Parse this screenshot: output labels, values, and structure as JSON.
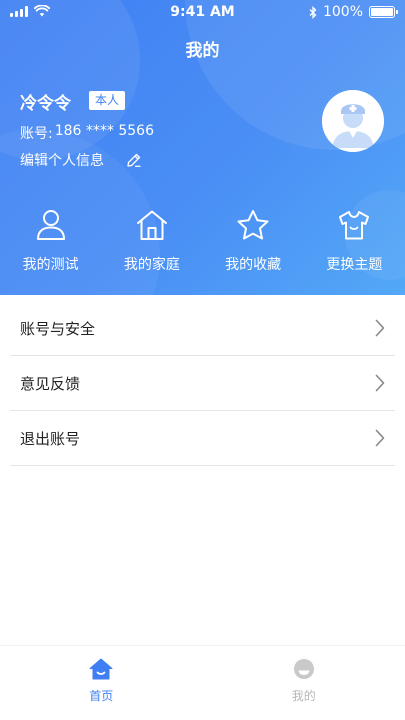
{
  "status_bar": {
    "time": "9:41 AM",
    "battery": "100%"
  },
  "header": {
    "title": "我的"
  },
  "profile": {
    "name": "冷令令",
    "badge": "本人",
    "account_label": "账号:",
    "account_value": "186 **** 5566",
    "edit_label": "编辑个人信息"
  },
  "shortcuts": [
    {
      "label": "我的测试",
      "icon": "user-icon"
    },
    {
      "label": "我的家庭",
      "icon": "home-icon"
    },
    {
      "label": "我的收藏",
      "icon": "star-icon"
    },
    {
      "label": "更换主题",
      "icon": "shirt-icon"
    }
  ],
  "menu": [
    {
      "label": "账号与安全"
    },
    {
      "label": "意见反馈"
    },
    {
      "label": "退出账号"
    }
  ],
  "tabbar": [
    {
      "label": "首页",
      "active": true
    },
    {
      "label": "我的",
      "active": false
    }
  ],
  "colors": {
    "accent": "#3f7ff3",
    "inactive": "#b8b8b8"
  }
}
